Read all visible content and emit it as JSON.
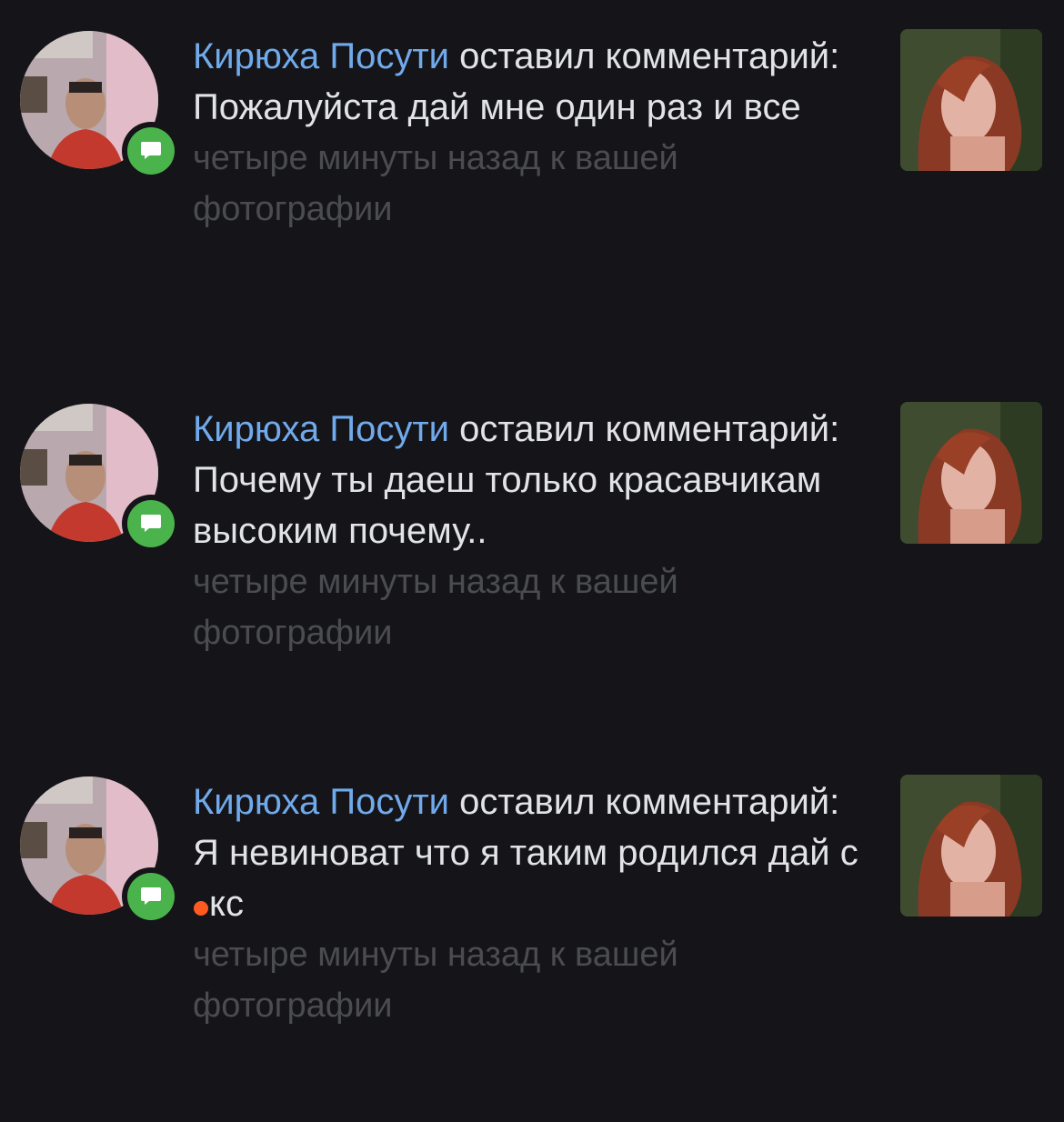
{
  "notifications": [
    {
      "author": "Кирюха Посути",
      "action": "оставил комментарий:",
      "comment": "Пожалуйста дай мне один раз и все",
      "meta": "четыре минуты назад к вашей фотографии"
    },
    {
      "author": "Кирюха Посути",
      "action": "оставил комментарий:",
      "comment": "Почему ты даеш только красавчикам высоким почему..",
      "meta": "четыре минуты назад к вашей фотографии"
    },
    {
      "author": "Кирюха Посути",
      "action": "оставил комментарий:",
      "comment_prefix": "Я невиноват что я таким родился дай с",
      "comment_suffix": "кс",
      "meta": "четыре минуты назад к вашей фотографии"
    }
  ],
  "colors": {
    "background": "#141419",
    "author_link": "#71aaeb",
    "text": "#e1e3e6",
    "meta": "#4a4c51",
    "badge": "#4bb34b"
  },
  "icons": {
    "badge": "comment-bubble-icon"
  }
}
